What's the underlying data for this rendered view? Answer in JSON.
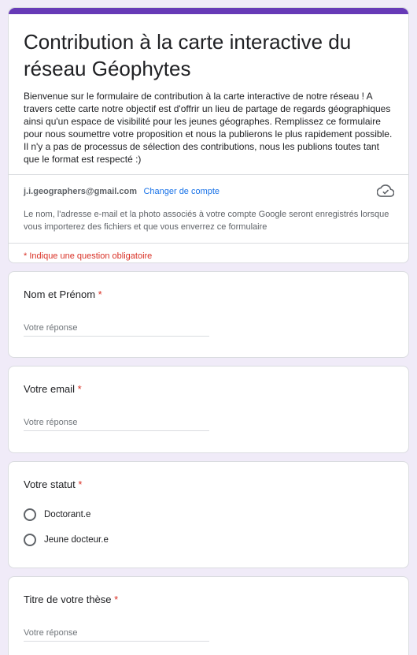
{
  "form": {
    "title": "Contribution à la carte interactive du réseau Géophytes",
    "description": "Bienvenue sur le formulaire de contribution à la carte interactive de notre réseau ! A travers cette carte notre objectif est d'offrir un lieu de partage de regards géographiques ainsi qu'un espace de visibilité pour les jeunes géographes. Remplissez ce formulaire pour nous soumettre votre proposition et nous la publierons le plus rapidement possible. Il n'y a pas de processus de sélection des contributions, nous les publions toutes tant que le format est respecté :)",
    "account_email": "j.i.geographers@gmail.com",
    "switch_account_label": "Changer de compte",
    "privacy_note": "Le nom, l'adresse e-mail et la photo associés à votre compte Google seront enregistrés lorsque vous importerez des fichiers et que vous enverrez ce formulaire",
    "required_note": "* Indique une question obligatoire",
    "accent_color": "#673ab7",
    "cloud_icon": "cloud-check-icon"
  },
  "questions": {
    "name": {
      "title": "Nom et Prénom",
      "required_mark": "*",
      "placeholder": "Votre réponse"
    },
    "email": {
      "title": "Votre email",
      "required_mark": "*",
      "placeholder": "Votre réponse"
    },
    "status": {
      "title": "Votre statut",
      "required_mark": "*",
      "options": [
        "Doctorant.e",
        "Jeune docteur.e"
      ]
    },
    "thesis": {
      "title": "Titre de votre thèse ",
      "required_mark": "*",
      "placeholder": "Votre réponse"
    }
  }
}
